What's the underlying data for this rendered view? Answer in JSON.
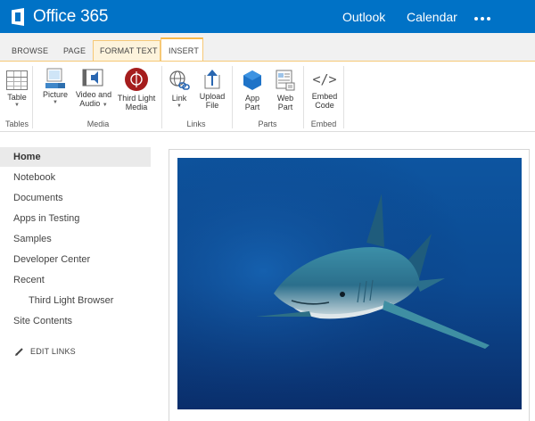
{
  "suite": {
    "brand": "Office 365",
    "nav": [
      "Outlook",
      "Calendar"
    ]
  },
  "tabs": [
    "BROWSE",
    "PAGE",
    "FORMAT TEXT",
    "INSERT"
  ],
  "ribbon": {
    "buttons": {
      "table": "Table",
      "picture": "Picture",
      "video_1": "Video and",
      "video_2": "Audio",
      "tl_1": "Third Light",
      "tl_2": "Media",
      "link": "Link",
      "upload_1": "Upload",
      "upload_2": "File",
      "app_1": "App",
      "app_2": "Part",
      "web_1": "Web",
      "web_2": "Part",
      "embed_1": "Embed",
      "embed_2": "Code"
    },
    "groups": [
      "Tables",
      "Media",
      "Links",
      "Parts",
      "Embed"
    ]
  },
  "nav": {
    "items": [
      "Home",
      "Notebook",
      "Documents",
      "Apps in Testing",
      "Samples",
      "Developer Center",
      "Recent",
      "Third Light Browser",
      "Site Contents"
    ],
    "edit_links": "EDIT LINKS"
  },
  "colors": {
    "suite_blue": "#0072c6",
    "tab_accent": "#f6b94d",
    "ocean_top": "#0d4f91",
    "ocean_bottom": "#0a2f6b"
  }
}
